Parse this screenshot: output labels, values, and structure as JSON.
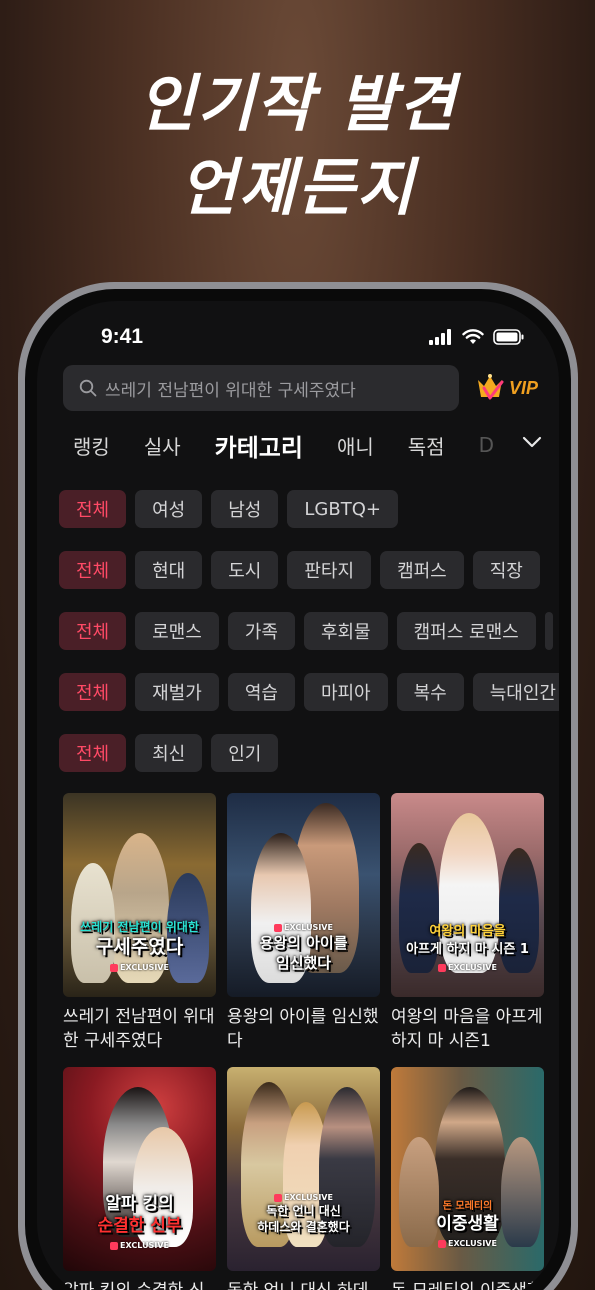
{
  "headline": {
    "line1": "인기작 발견",
    "line2": "언제든지"
  },
  "status": {
    "time": "9:41"
  },
  "search": {
    "placeholder": "쓰레기 전남편이 위대한 구세주였다",
    "vip_label": "VIP"
  },
  "tabs": [
    {
      "label": "랭킹"
    },
    {
      "label": "실사"
    },
    {
      "label": "카테고리"
    },
    {
      "label": "애니"
    },
    {
      "label": "독점"
    },
    {
      "label": "D"
    }
  ],
  "filters": {
    "audience": [
      "전체",
      "여성",
      "남성",
      "LGBTQ+"
    ],
    "setting": [
      "전체",
      "현대",
      "도시",
      "판타지",
      "캠퍼스",
      "직장"
    ],
    "theme": [
      "전체",
      "로맨스",
      "가족",
      "후회물",
      "캠퍼스 로맨스"
    ],
    "trope": [
      "전체",
      "재벌가",
      "역습",
      "마피아",
      "복수",
      "늑대인간"
    ],
    "sort": [
      "전체",
      "최신",
      "인기"
    ]
  },
  "cards": [
    {
      "title": "쓰레기 전남편이 위대한 구세주였다",
      "cover_line1": "쓰레기 전남편이 위대한",
      "cover_line2": "구세주였다",
      "exclusive": "EXCLUSIVE",
      "bg": "#6b5a34",
      "accent": "#26e0d0"
    },
    {
      "title": "용왕의 아이를 임신했다",
      "cover_line1": "용왕의 아이를",
      "cover_line2": "임신했다",
      "exclusive": "EXCLUSIVE",
      "bg": "#2d3f5a",
      "accent": "#ffffff"
    },
    {
      "title": "여왕의 마음을 아프게 하지 마 시즌1",
      "cover_line1": "여왕의 마음을",
      "cover_line2": "아프게 하지 마 시즌 1",
      "exclusive": "EXCLUSIVE",
      "bg": "#8a5d5d",
      "accent": "#ffd23a"
    },
    {
      "title": "알파 킹의 순결한 신부",
      "cover_line1": "알파 킹의",
      "cover_line2": "순결한 신부",
      "exclusive": "EXCLUSIVE",
      "bg": "#6b1a1f",
      "accent": "#ff3030"
    },
    {
      "title": "독한 언니 대신 하데스와 결혼했다",
      "cover_line1": "독한 언니 대신",
      "cover_line2": "하데스와 결혼했다",
      "exclusive": "EXCLUSIVE",
      "bg": "#5a4a30",
      "accent": "#ffffff"
    },
    {
      "title": "돈 모레티의 이중생활",
      "cover_line1": "돈 모레티의",
      "cover_line2": "이중생활",
      "exclusive": "EXCLUSIVE",
      "bg": "#3a4e52",
      "accent": "#ff7a2a"
    }
  ]
}
